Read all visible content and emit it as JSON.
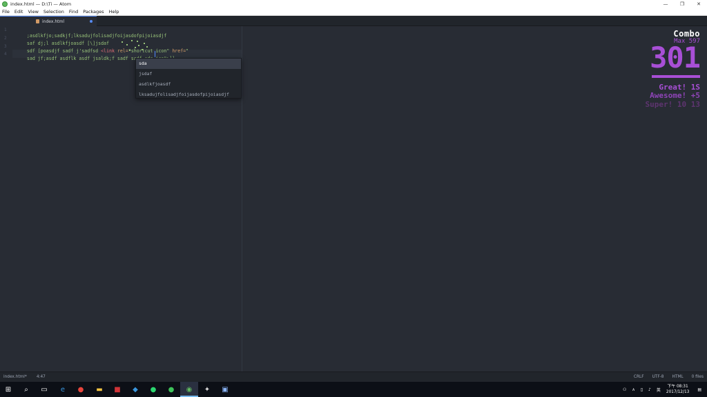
{
  "window": {
    "title": "index.html — D:\\Ti — Atom",
    "minimize": "—",
    "maximize": "❐",
    "close": "✕"
  },
  "menu": [
    "File",
    "Edit",
    "View",
    "Selection",
    "Find",
    "Packages",
    "Help"
  ],
  "tab": {
    "title": "index.html"
  },
  "gutter": [
    "1",
    "2",
    "3",
    "4"
  ],
  "code": {
    "line1": ";asdlkfjo;sadkjf;lksadujfolisadjfoijasdofpijoiasdjf",
    "line2": "saf dj;l asdlkfjoasdf [\\]jsdaf",
    "line3_a": "sdf [poasdjf sadf j'sadfsd ",
    "line3_tag": "<link",
    "line3_attr": " rel=",
    "line3_str": "\"shortcut icon\"",
    "line3_attr2": " href=",
    "line3_str2": "\"",
    "line4_a": "sad jf;asdf asdflk asdf jsaldk;f sadf sadf sda",
    "line4_b": ".ico\">]]"
  },
  "autocomplete": [
    "sda",
    "jsdaf",
    "asdlkfjoasdf",
    "lksadujfolisadjfoijasdofpijoiasdjf"
  ],
  "combo": {
    "title": "Combo",
    "max": "Max 597",
    "count": "301",
    "exclamations": [
      "Great! 1S",
      "Awesome! +5",
      "Super! 10 13"
    ]
  },
  "status": {
    "file": "index.html*",
    "position": "4:47",
    "line_ending": "CRLF",
    "encoding": "UTF-8",
    "grammar": "HTML",
    "files": "0 files"
  },
  "taskbar": {
    "time": "下午 08:31",
    "date": "2017/12/13",
    "ime": "英"
  },
  "colors": {
    "accent": "#568af2",
    "combo": "#a84fd6"
  }
}
